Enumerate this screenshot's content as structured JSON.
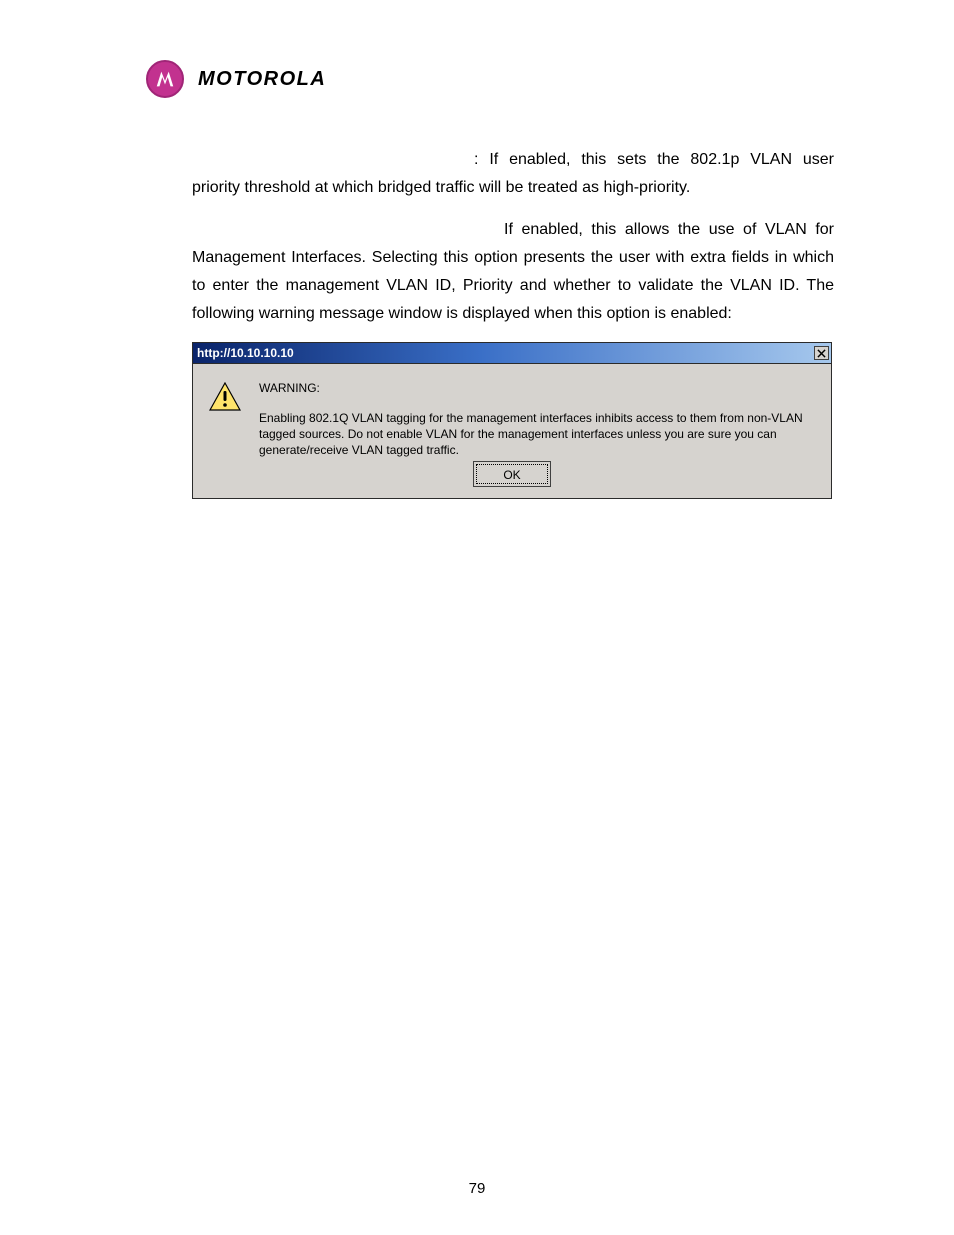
{
  "header": {
    "brand": "MOTOROLA"
  },
  "body": {
    "para1_lead": ": ",
    "para1": "If enabled, this sets the 802.1p VLAN user priority threshold at which bridged traffic will be treated as high-priority.",
    "para2": "If enabled, this allows the use of VLAN for Management Interfaces. Selecting this option presents the user with extra fields in which to enter the management VLAN ID, Priority and whether to validate the VLAN ID. The following warning message window is displayed when this option is enabled:"
  },
  "dialog": {
    "title": "http://10.10.10.10",
    "heading": "WARNING:",
    "message": "Enabling 802.1Q VLAN tagging for the management interfaces inhibits access to them from non-VLAN tagged sources. Do not enable VLAN for the management interfaces unless you are sure you can generate/receive VLAN tagged traffic.",
    "ok_label": "OK"
  },
  "page_number": "79"
}
